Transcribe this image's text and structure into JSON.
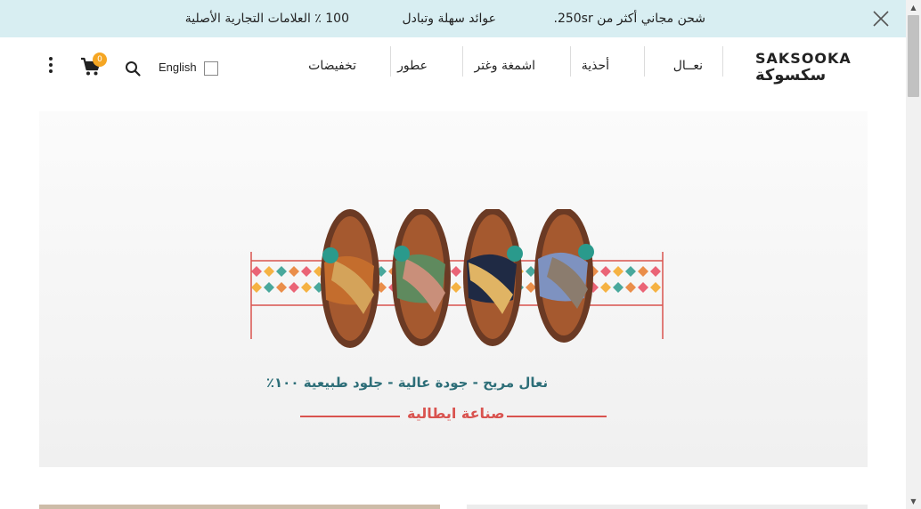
{
  "promo": {
    "messages": [
      "100 ٪ العلامات التجارية الأصلية",
      "عوائد سهلة وتبادل",
      "شحن مجاني أكثر من 250sr."
    ],
    "close_icon": "close-icon"
  },
  "header": {
    "logo_latin": "SAKSOOKA",
    "logo_arabic": "سكسوكة",
    "nav": [
      "نعــال",
      "أحذية",
      "اشمغة وغتر",
      "عطور",
      "تخفيضات"
    ],
    "language_label": "English",
    "cart_count": "0",
    "icons": [
      "search-icon",
      "cart-icon",
      "more-vertical-icon"
    ],
    "badge_color": "#f5a623"
  },
  "hero": {
    "tagline": "نعال مريح - جودة عالية - جلود طبيعية ١٠٠٪",
    "made_in": "صناعة ايطالية",
    "accent_color": "#d9534f",
    "tagline_color": "#2d6e78"
  }
}
